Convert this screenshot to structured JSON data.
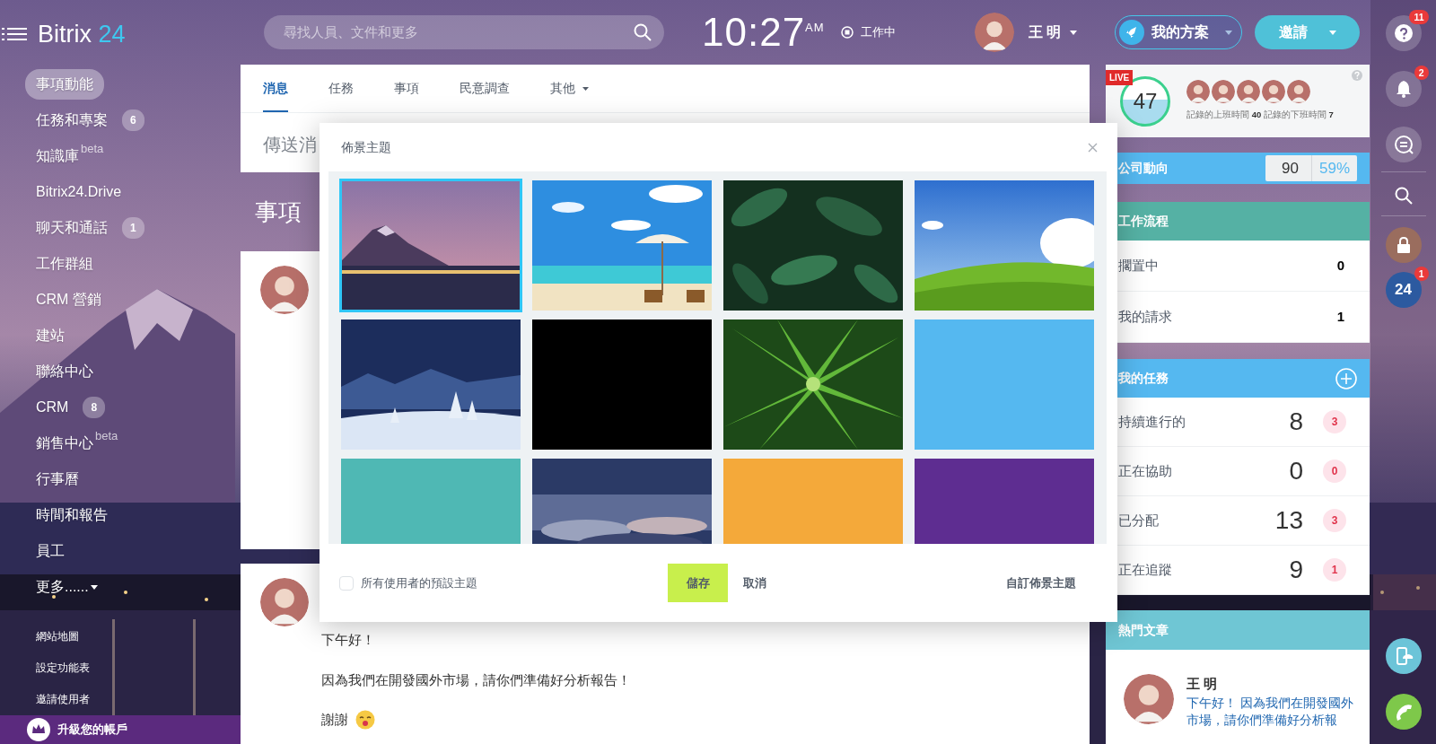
{
  "header": {
    "logo": {
      "name": "Bitrix",
      "number": "24"
    },
    "search": {
      "placeholder": "尋找人員、文件和更多"
    },
    "clock": {
      "time": "10:27",
      "meridiem": "AM"
    },
    "work_status": "工作中",
    "user": {
      "name": "王 明"
    },
    "plan_button": "我的方案",
    "invite_button": "邀請"
  },
  "sidebar": {
    "items": [
      {
        "label": "事項動能",
        "selected": true
      },
      {
        "label": "任務和專案",
        "counter": "6",
        "selected": false
      },
      {
        "label": "知識庫",
        "tag": "beta",
        "selected": false
      },
      {
        "label": "Bitrix24.Drive",
        "selected": false
      },
      {
        "label": "聊天和通話",
        "counter": "1",
        "selected": false
      },
      {
        "label": "工作群組",
        "selected": false
      },
      {
        "label": "CRM 營銷",
        "selected": false
      },
      {
        "label": "建站",
        "selected": false
      },
      {
        "label": "聯絡中心",
        "selected": false
      },
      {
        "label": "CRM",
        "counter": "8",
        "selected": false
      },
      {
        "label": "銷售中心",
        "tag": "beta",
        "selected": false
      },
      {
        "label": "行事曆",
        "selected": false
      },
      {
        "label": "時間和報告",
        "selected": false
      },
      {
        "label": "員工",
        "selected": false
      },
      {
        "label": "更多......",
        "dropdown": true,
        "selected": false
      }
    ],
    "footer_links": [
      "網站地圖",
      "設定功能表",
      "邀請使用者"
    ],
    "upgrade": "升級您的帳戶"
  },
  "feed": {
    "tabs": [
      {
        "label": "消息",
        "selected": true
      },
      {
        "label": "任務",
        "selected": false
      },
      {
        "label": "事項",
        "selected": false
      },
      {
        "label": "民意調查",
        "selected": false
      },
      {
        "label": "其他",
        "dropdown": true,
        "selected": false
      }
    ],
    "composer_placeholder": "傳送消",
    "title": "事項",
    "post": {
      "lines": [
        "下午好！",
        "因為我們在開發國外市場，請你們準備好分析報告！",
        "謝謝"
      ]
    }
  },
  "dialog": {
    "title": "佈景主題",
    "themes": [
      {
        "kind": "picture",
        "selected": true
      },
      {
        "kind": "picture",
        "selected": false
      },
      {
        "kind": "picture",
        "selected": false
      },
      {
        "kind": "picture",
        "selected": false
      },
      {
        "kind": "picture",
        "selected": false
      },
      {
        "kind": "color",
        "color": "#000000",
        "selected": false
      },
      {
        "kind": "picture",
        "selected": false
      },
      {
        "kind": "color",
        "color": "#55b8f0",
        "selected": false
      },
      {
        "kind": "color",
        "color": "#4fb8b4",
        "selected": false
      },
      {
        "kind": "picture",
        "selected": false
      },
      {
        "kind": "color",
        "color": "#f4a93a",
        "selected": false
      },
      {
        "kind": "color",
        "color": "#5e2d91",
        "selected": false
      }
    ],
    "default_checkbox": {
      "label": "所有使用者的預設主題",
      "checked": false
    },
    "save": "儲存",
    "cancel": "取消",
    "custom": "自訂佈景主題"
  },
  "right": {
    "live": {
      "badge": "LIVE",
      "count": "47",
      "clocked_in_label": "記錄的上班時間",
      "clocked_in": "40",
      "clocked_out_label": "記錄的下班時間",
      "clocked_out": "7"
    },
    "pulse": {
      "label": "公司動向",
      "value": "90",
      "percent": "59%"
    },
    "workflow": {
      "title": "工作流程",
      "rows": [
        {
          "label": "擱置中",
          "count": "0"
        },
        {
          "label": "我的請求",
          "count": "1"
        }
      ]
    },
    "tasks": {
      "title": "我的任務",
      "rows": [
        {
          "label": "持續進行的",
          "count": "8",
          "badge": "3"
        },
        {
          "label": "正在協助",
          "count": "0",
          "badge": "0"
        },
        {
          "label": "已分配",
          "count": "13",
          "badge": "3"
        },
        {
          "label": "正在追蹤",
          "count": "9",
          "badge": "1"
        }
      ]
    },
    "popular": {
      "title": "熱門文章",
      "author": "王 明",
      "text": "下午好！ 因為我們在開發國外市場，請你們準備好分析報"
    }
  },
  "rail": {
    "help_badge": "11",
    "notifications_badge": "2",
    "bitrix_label": "24",
    "bitrix_badge": "1"
  }
}
